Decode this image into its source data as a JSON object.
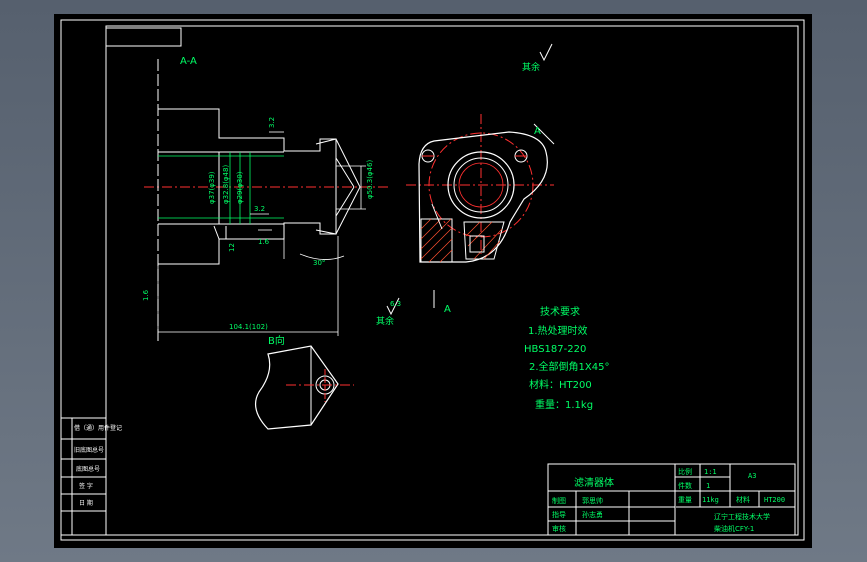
{
  "section_label": "A-A",
  "view_a_label": "A",
  "view_a_label_right": "A",
  "view_b_label": "B向",
  "roughness_note_top": "其余",
  "roughness_note_bottom": "其余",
  "roughness_value_bottom": "6.3",
  "dimensions": {
    "roughness_3_2_top": "3.2",
    "roughness_3_2_mid": "3.2",
    "dim_12": "12",
    "dim_1_6": "1.6",
    "dim_phi37": "φ37(φ39)",
    "dim_phi32": "φ32.8(φ48)",
    "dim_phi29": "φ29(φ30)",
    "dim_phi50": "φ50.3(φ46)",
    "angle_30": "30°",
    "dim_length": "104.1(102)",
    "dim_left_side": "1.6"
  },
  "tech_requirements": {
    "title": "技术要求",
    "line1": "1.热处理时效",
    "line2": "HBS187-220",
    "line3": "2.全部倒角1X45°",
    "material": "材料：HT200",
    "weight": "重量：1.1kg"
  },
  "title_block": {
    "part_name": "滤清器体",
    "scale_label": "比例",
    "scale_value": "1:1",
    "qty_label": "件数",
    "qty_value": "1",
    "sheet_size": "A3",
    "weight_label": "重量",
    "weight_value": "11kg",
    "material_label": "材料",
    "material_value": "HT200",
    "drawn_label": "制图",
    "drawn_name": "郭思帅",
    "designer_label": "指导",
    "designer_name": "孙志勇",
    "review_label": "审核",
    "school": "辽宁工程技术大学",
    "drawing_no": "柴油机CFY-1"
  },
  "left_strip": {
    "r1": "借（通）用件登记",
    "r2": "旧底图总号",
    "r3": "底图总号",
    "r4": "签 字",
    "r5": "日 期"
  }
}
